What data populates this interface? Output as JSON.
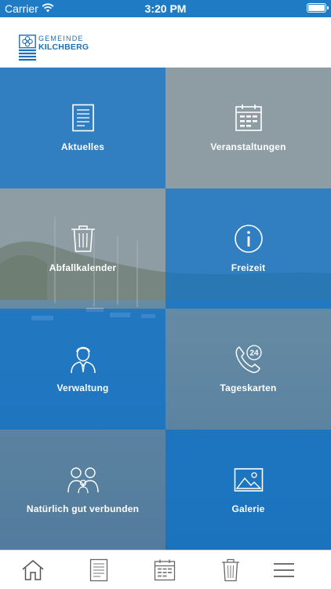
{
  "status_bar": {
    "carrier": "Carrier",
    "time": "3:20 PM",
    "battery_level": 1.0
  },
  "header": {
    "logo_line1": "GEMEINDE",
    "logo_line2": "KILCHBERG"
  },
  "tiles": [
    {
      "label": "Aktuelles",
      "icon": "document-icon"
    },
    {
      "label": "Veranstaltungen",
      "icon": "calendar-icon"
    },
    {
      "label": "Abfallkalender",
      "icon": "trash-icon"
    },
    {
      "label": "Freizeit",
      "icon": "info-icon"
    },
    {
      "label": "Verwaltung",
      "icon": "person-icon"
    },
    {
      "label": "Tageskarten",
      "icon": "phone-24-icon"
    },
    {
      "label": "Natürlich gut verbunden",
      "icon": "family-icon"
    },
    {
      "label": "Galerie",
      "icon": "image-icon"
    }
  ],
  "tab_bar": [
    {
      "icon": "home-icon"
    },
    {
      "icon": "document-icon"
    },
    {
      "icon": "calendar-icon"
    },
    {
      "icon": "trash-icon"
    },
    {
      "icon": "menu-icon"
    }
  ],
  "colors": {
    "brand_blue": "#1f6fb5",
    "tile_blue": "#1876c6",
    "status_bar": "#1f7bc4",
    "icon_gray": "#555555"
  }
}
